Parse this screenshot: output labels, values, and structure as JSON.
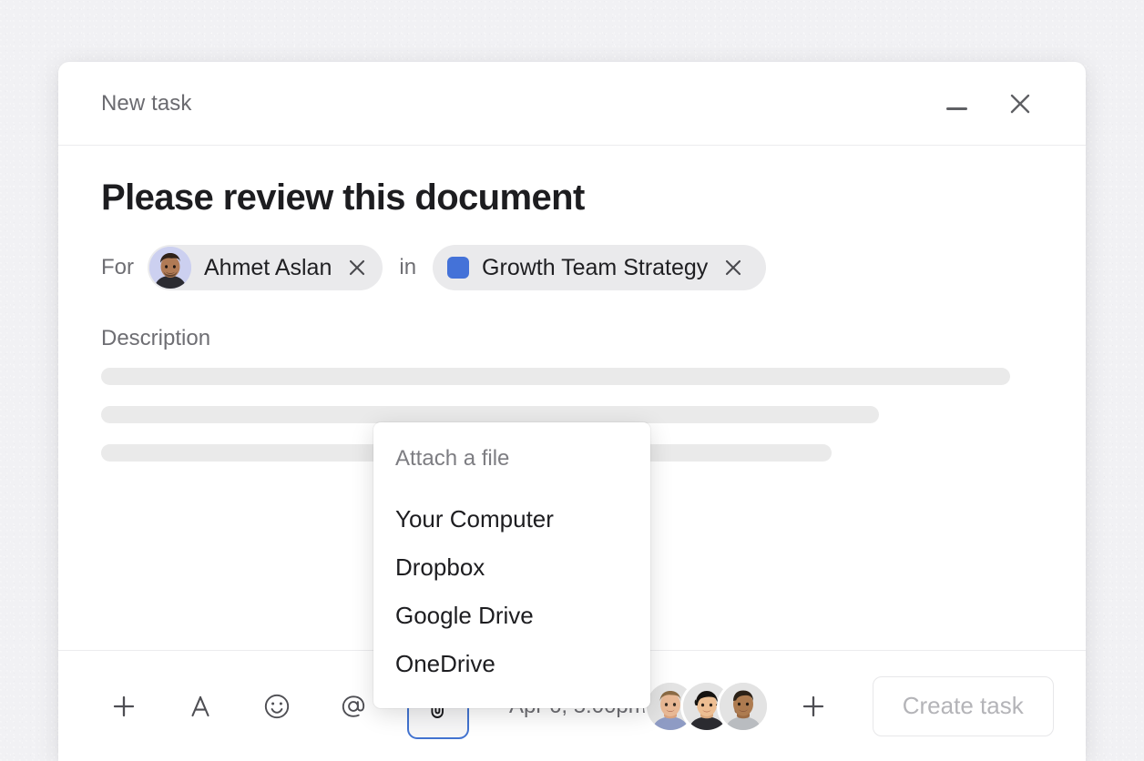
{
  "window": {
    "title": "New task",
    "minimize_label": "Minimize",
    "close_label": "Close"
  },
  "task": {
    "title": "Please review this document",
    "for_label": "For",
    "in_label": "in",
    "assignee": {
      "name": "Ahmet Aslan",
      "remove_label": "Remove assignee",
      "avatar_bg": "#ccd0f0"
    },
    "project": {
      "name": "Growth Team Strategy",
      "color": "#4472d8",
      "remove_label": "Remove project"
    },
    "description_label": "Description"
  },
  "attach_menu": {
    "title": "Attach a file",
    "items": [
      {
        "label": "Your Computer"
      },
      {
        "label": "Dropbox"
      },
      {
        "label": "Google Drive"
      },
      {
        "label": "OneDrive"
      }
    ]
  },
  "toolbar": {
    "add_label": "Add",
    "format_label": "A",
    "emoji_label": "Emoji",
    "mention_label": "Mention",
    "attach_label": "Attach file",
    "due_date": "Apr 6, 5:00pm",
    "add_collaborator_label": "Add collaborator",
    "create_label": "Create task",
    "active_accent": "#4273d0"
  },
  "collaborators": [
    {
      "name": "Collaborator 1"
    },
    {
      "name": "Collaborator 2"
    },
    {
      "name": "Collaborator 3"
    }
  ],
  "colors": {
    "backdrop": "#f1f1f4",
    "card": "#ffffff",
    "chip_bg": "#eaeaec",
    "skeleton": "#eaeaea",
    "muted_text": "#6e6e73"
  }
}
